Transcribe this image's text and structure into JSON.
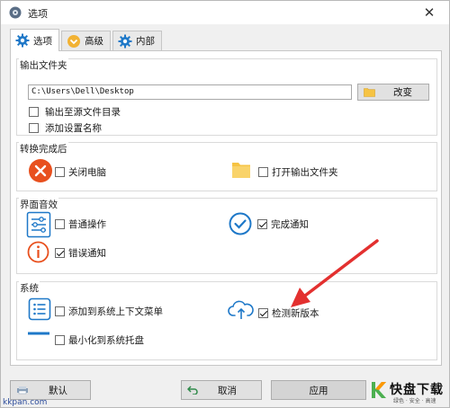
{
  "window": {
    "title": "选项"
  },
  "tabs": [
    {
      "label": "选项",
      "icon": "gear-icon",
      "active": true
    },
    {
      "label": "高级",
      "icon": "chevron-down-circle-icon",
      "active": false
    },
    {
      "label": "内部",
      "icon": "gear-icon",
      "active": false
    }
  ],
  "output_folder": {
    "title": "输出文件夹",
    "path_value": "C:\\Users\\Dell\\Desktop",
    "change_label": "改变",
    "options": [
      {
        "label": "输出至源文件目录",
        "checked": false
      },
      {
        "label": "添加设置名称",
        "checked": false
      }
    ]
  },
  "after_convert": {
    "title": "转换完成后",
    "options": [
      {
        "label": "关闭电脑",
        "checked": false,
        "icon": "close-circle-icon"
      },
      {
        "label": "打开输出文件夹",
        "checked": false,
        "icon": "folder-icon"
      }
    ]
  },
  "ui_sound": {
    "title": "界面音效",
    "options": [
      {
        "label": "普通操作",
        "checked": false,
        "icon": "sliders-icon"
      },
      {
        "label": "完成通知",
        "checked": true,
        "icon": "check-circle-icon"
      },
      {
        "label": "错误通知",
        "checked": true,
        "icon": "info-circle-icon"
      }
    ]
  },
  "system": {
    "title": "系统",
    "options": [
      {
        "label": "添加到系统上下文菜单",
        "checked": false,
        "icon": "list-icon"
      },
      {
        "label": "检测新版本",
        "checked": true,
        "icon": "cloud-upload-icon"
      },
      {
        "label": "最小化到系统托盘",
        "checked": false,
        "icon": "minus-icon"
      }
    ]
  },
  "buttons": {
    "default": "默认",
    "cancel": "取消",
    "apply": "应用"
  },
  "watermark": {
    "url": "kkpan.com",
    "logo_text": "快盘下载",
    "logo_sub": "绿色 · 安全 · 高速"
  },
  "colors": {
    "accent_blue": "#1e78c8",
    "red": "#e8501e",
    "folder": "#f6c343",
    "arrow_red": "#e3302f"
  }
}
